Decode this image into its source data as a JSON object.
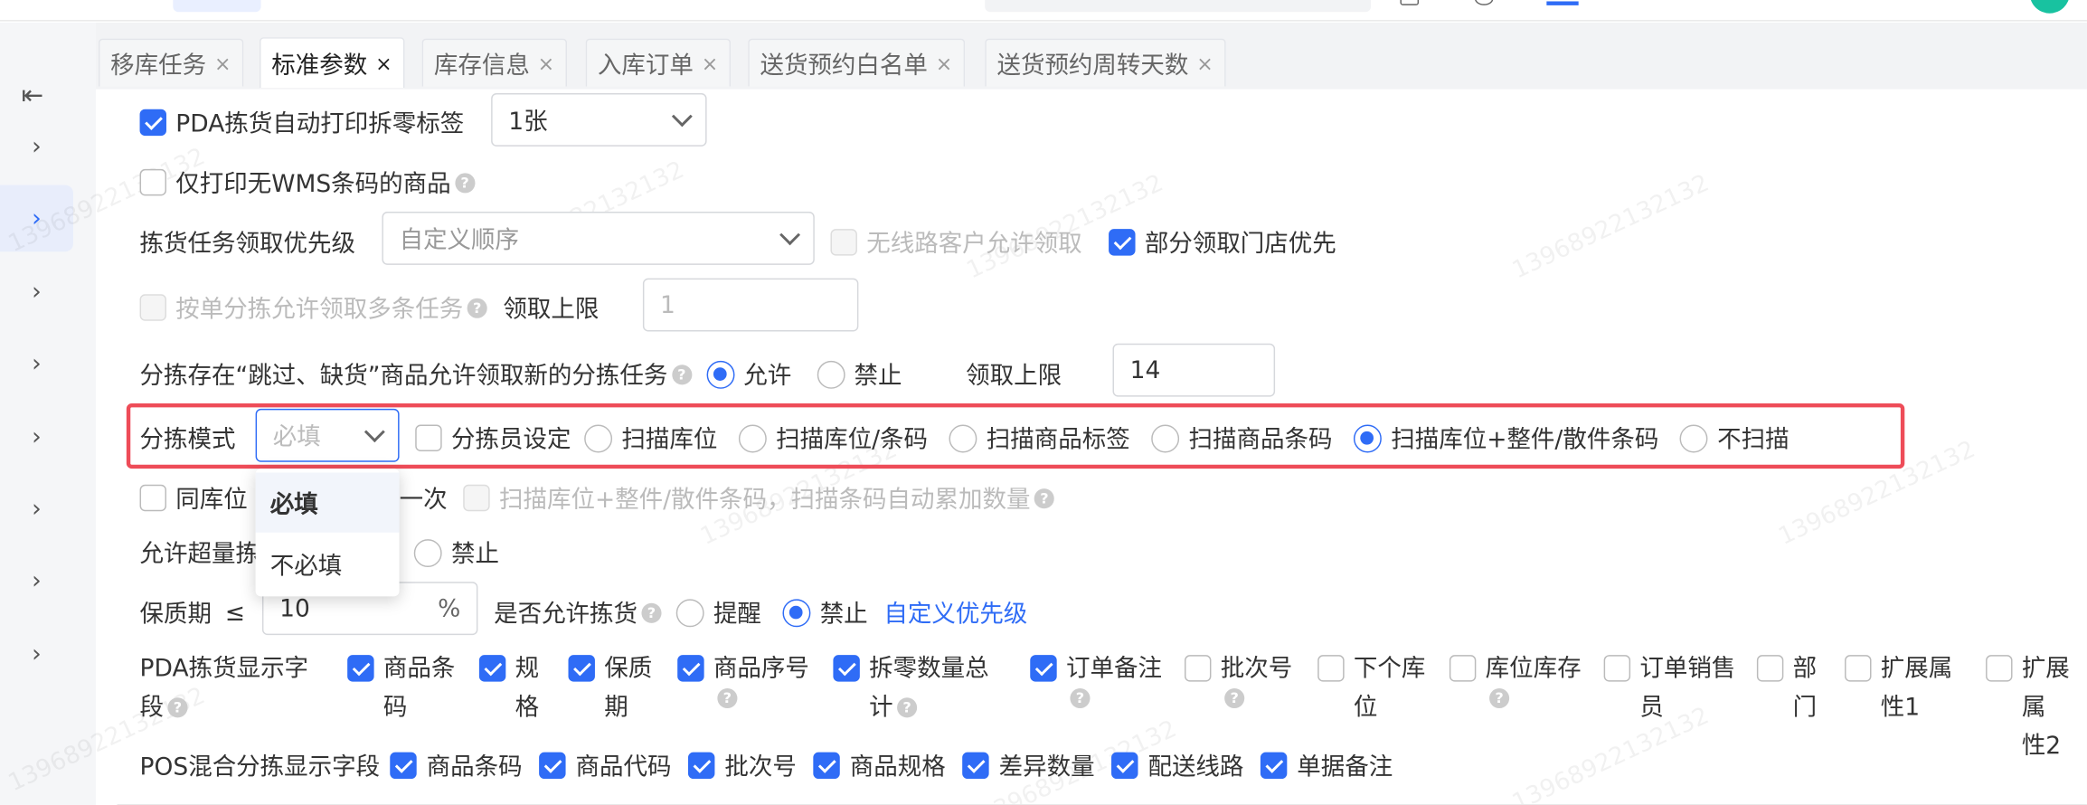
{
  "tabs": [
    {
      "label": "移库任务"
    },
    {
      "label": "标准参数"
    },
    {
      "label": "库存信息"
    },
    {
      "label": "入库订单"
    },
    {
      "label": "送货预约白名单"
    },
    {
      "label": "送货预约周转天数"
    }
  ],
  "close_glyph": "×",
  "sidebar": {
    "collapse_icon": "collapse-left-icon",
    "items": [
      "chevron-right-icon",
      "chevron-right-icon",
      "chevron-right-icon",
      "chevron-right-icon",
      "chevron-right-icon",
      "chevron-right-icon",
      "chevron-right-icon",
      "chevron-right-icon"
    ]
  },
  "form": {
    "pda_auto_print": {
      "label": "PDA拣货自动打印拆零标签",
      "checked": true,
      "select_value": "1张"
    },
    "print_no_wms": {
      "label": "仅打印无WMS条码的商品",
      "checked": false
    },
    "priority": {
      "label": "拣货任务领取优先级",
      "select_value": "自定义顺序",
      "wireless": "无线路客户允许领取",
      "partial": "部分领取门店优先"
    },
    "multi_task": {
      "label": "按单分拣允许领取多条任务",
      "limit_label": "领取上限",
      "limit_value": "1"
    },
    "skip": {
      "label": "分拣存在“跳过、缺货”商品允许领取新的分拣任务",
      "allow": "允许",
      "forbid": "禁止",
      "limit_label": "领取上限",
      "limit_value": "14"
    },
    "sort_mode": {
      "label": "分拣模式",
      "select_placeholder": "必填",
      "options": [
        "分拣员设定",
        "扫描库位",
        "扫描库位/条码",
        "扫描商品标签",
        "扫描商品条码",
        "扫描库位+整件/散件条码",
        "不扫描"
      ],
      "selected_option": "扫描库位+整件/散件条码"
    },
    "same_loc": {
      "label_a": "同库位",
      "label_b": "一次",
      "auto_add": "扫描库位+整件/散件条码，扫描条码自动累加数量"
    },
    "over_pick": {
      "label": "允许超量拣",
      "forbid": "禁止"
    },
    "shelf": {
      "label": "保质期",
      "le": "≤",
      "value": "10",
      "unit": "%",
      "allow_label": "是否允许拣货",
      "remind": "提醒",
      "forbid": "禁止",
      "link": "自定义优先级"
    },
    "pda_fields": {
      "label_line1": "PDA拣货显示字",
      "label_line2": "段",
      "items": [
        {
          "l1": "商品条",
          "l2": "码",
          "checked": true,
          "help": false
        },
        {
          "l1": "规",
          "l2": "格",
          "checked": true,
          "help": false
        },
        {
          "l1": "保质",
          "l2": "期",
          "checked": true,
          "help": false
        },
        {
          "l1": "商品序号",
          "l2": "",
          "checked": true,
          "help": true
        },
        {
          "l1": "拆零数量总",
          "l2": "计",
          "checked": true,
          "help": true
        },
        {
          "l1": "订单备注",
          "l2": "",
          "checked": true,
          "help": true
        },
        {
          "l1": "批次号",
          "l2": "",
          "checked": false,
          "help": true
        },
        {
          "l1": "下个库",
          "l2": "位",
          "checked": false,
          "help": false
        },
        {
          "l1": "库位库存",
          "l2": "",
          "checked": false,
          "help": true
        },
        {
          "l1": "订单销售",
          "l2": "员",
          "checked": false,
          "help": false
        },
        {
          "l1": "部",
          "l2": "门",
          "checked": false,
          "help": false
        },
        {
          "l1": "扩展属",
          "l2": "性1",
          "checked": false,
          "help": false
        },
        {
          "l1": "扩展属",
          "l2": "性2",
          "checked": false,
          "help": false
        }
      ]
    },
    "pos_fields": {
      "label": "POS混合分拣显示字段",
      "items": [
        "商品条码",
        "商品代码",
        "批次号",
        "商品规格",
        "差异数量",
        "配送线路",
        "单据备注"
      ]
    }
  },
  "dropdown": {
    "options": [
      "必填",
      "不必填"
    ],
    "active": "必填"
  },
  "watermark": "13968922132132",
  "colors": {
    "primary": "#2f6cf6",
    "highlight": "#ee4c58"
  }
}
